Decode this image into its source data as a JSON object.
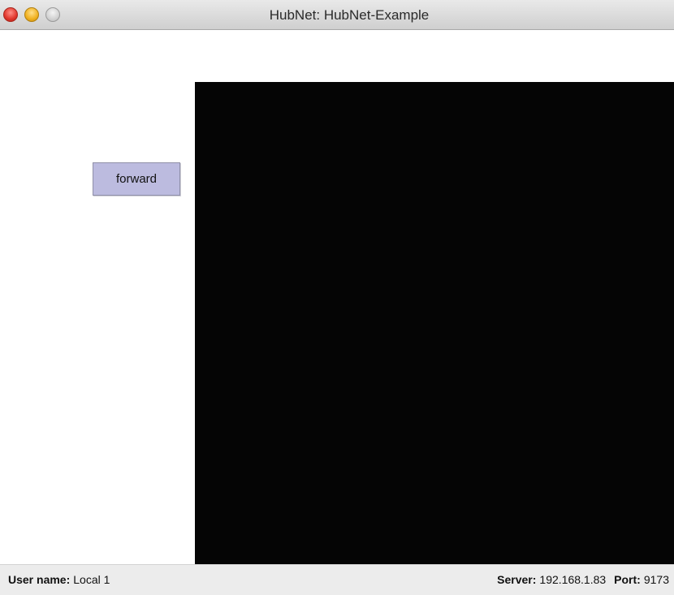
{
  "window": {
    "title": "HubNet: HubNet-Example"
  },
  "controls": {
    "forward_label": "forward"
  },
  "status": {
    "user_name_label": "User name:",
    "user_name_value": "Local 1",
    "server_label": "Server:",
    "server_value": "192.168.1.83",
    "port_label": "Port:",
    "port_value": "9173"
  },
  "colors": {
    "button_bg": "#bcbbdf",
    "world_bg": "#050505"
  },
  "icons": [
    "close-icon",
    "minimize-icon",
    "zoom-icon"
  ]
}
